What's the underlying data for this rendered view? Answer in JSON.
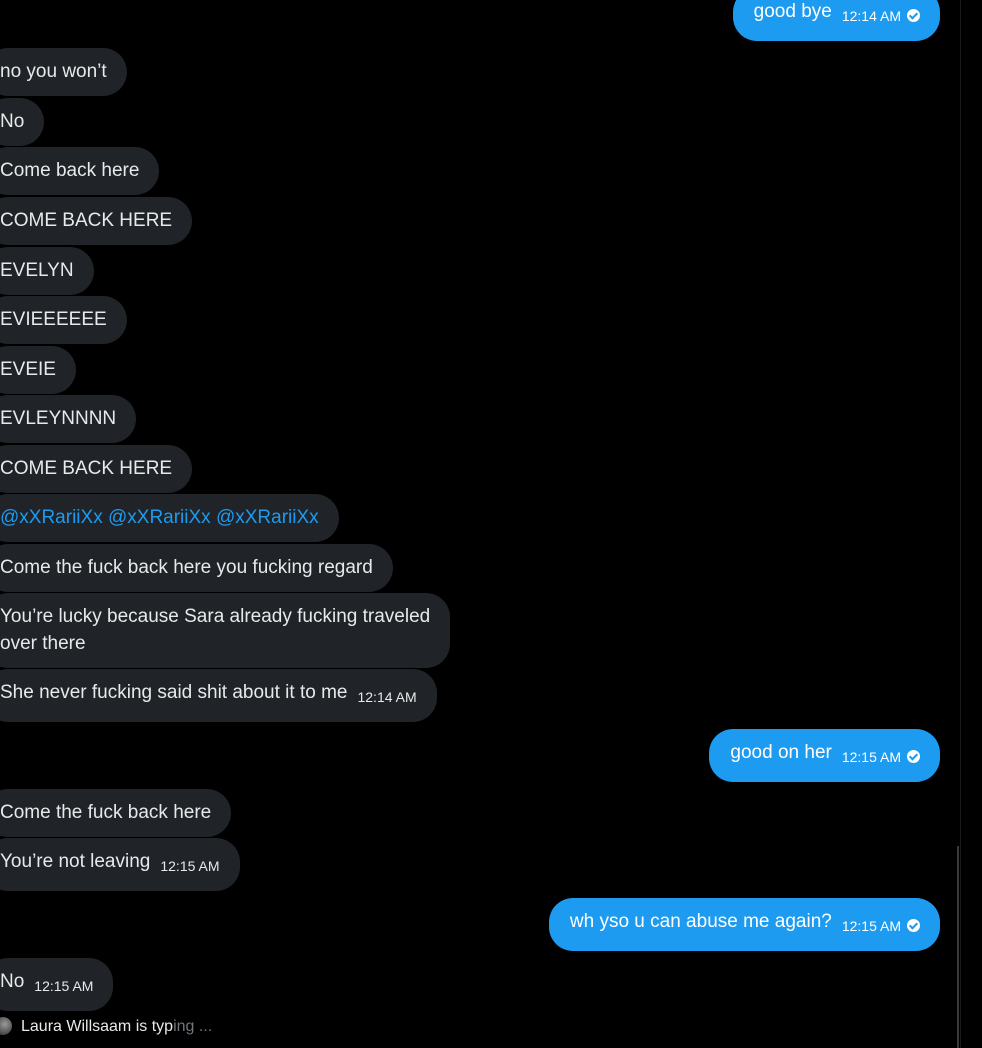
{
  "conversation": {
    "messages": [
      {
        "id": "m1",
        "side": "out",
        "text": "good bye",
        "time": "12:14 AM",
        "read": true
      },
      {
        "id": "m2",
        "side": "in",
        "text": "no you won’t"
      },
      {
        "id": "m3",
        "side": "in",
        "text": "No"
      },
      {
        "id": "m4",
        "side": "in",
        "text": "Come back here"
      },
      {
        "id": "m5",
        "side": "in",
        "text": "COME BACK HERE"
      },
      {
        "id": "m6",
        "side": "in",
        "text": "EVELYN"
      },
      {
        "id": "m7",
        "side": "in",
        "text": "EVIEEEEEE"
      },
      {
        "id": "m8",
        "side": "in",
        "text": "EVEIE"
      },
      {
        "id": "m9",
        "side": "in",
        "text": "EVLEYNNNN"
      },
      {
        "id": "m10",
        "side": "in",
        "text": "COME BACK HERE"
      },
      {
        "id": "m11",
        "side": "in",
        "mentions": [
          "@xXRariiXx",
          "@xXRariiXx",
          "@xXRariiXx"
        ]
      },
      {
        "id": "m12",
        "side": "in",
        "text": "Come the fuck back here you fucking regard"
      },
      {
        "id": "m13",
        "side": "in",
        "text_line1": "You’re lucky because Sara already fucking traveled",
        "text_line2": "over there"
      },
      {
        "id": "m14",
        "side": "in",
        "text": "She never fucking said shit about it to me",
        "time": "12:14 AM"
      },
      {
        "id": "m15",
        "side": "out",
        "text": "good on her",
        "time": "12:15 AM",
        "read": true
      },
      {
        "id": "m16",
        "side": "in",
        "text": "Come the fuck back here"
      },
      {
        "id": "m17",
        "side": "in",
        "text": "You’re not leaving",
        "time": "12:15 AM"
      },
      {
        "id": "m18",
        "side": "out",
        "text": "wh yso u can abuse me again?",
        "time": "12:15 AM",
        "read": true
      },
      {
        "id": "m19",
        "side": "in",
        "text": "No",
        "time": "12:15 AM"
      }
    ]
  },
  "typing_indicator": {
    "name": "Laura Willsaam",
    "status": "is typ",
    "status_faded": "ing ..."
  },
  "colors": {
    "background": "#000000",
    "incoming_bubble": "#202327",
    "outgoing_bubble": "#1d9bf0",
    "mention": "#1d9bf0",
    "text": "#e7e9ea"
  },
  "icons": {
    "read_receipt": "check-circle-icon",
    "typing_avatar": "avatar"
  }
}
